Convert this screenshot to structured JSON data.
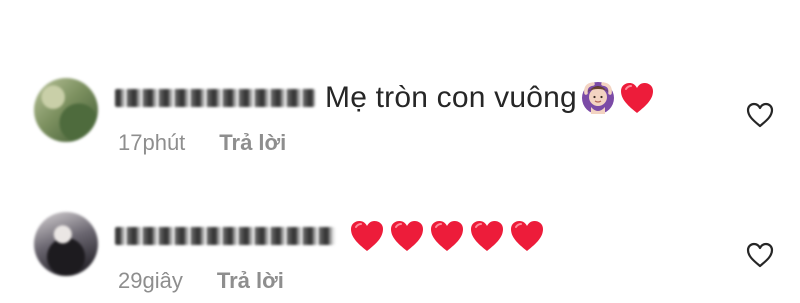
{
  "comments": [
    {
      "username": "",
      "text": "Mẹ tròn con vuông",
      "emojis": [
        "woman-gesturing-ok-emoji",
        "red-heart-emoji"
      ],
      "time": "17phút",
      "reply_label": "Trả lời",
      "like_icon": "heart-outline-icon"
    },
    {
      "username": "",
      "text": "",
      "emojis": [
        "red-heart-emoji",
        "red-heart-emoji",
        "red-heart-emoji",
        "red-heart-emoji",
        "red-heart-emoji"
      ],
      "time": "29giây",
      "reply_label": "Trả lời",
      "like_icon": "heart-outline-icon"
    }
  ],
  "colors": {
    "text": "#262626",
    "meta": "#8e8e8e",
    "heart": "#ed1c3a",
    "background": "#ffffff"
  }
}
